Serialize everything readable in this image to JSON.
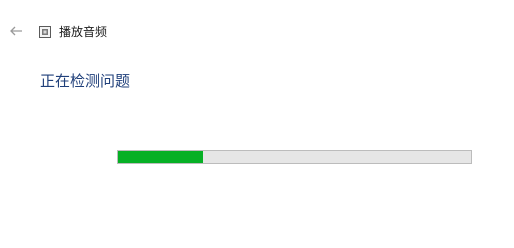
{
  "window": {
    "title": "播放音频",
    "back_icon": "back-arrow-icon",
    "app_icon": "troubleshooter-icon"
  },
  "main": {
    "heading": "正在检测问题",
    "progress": {
      "value_fraction": 0.24,
      "fill_color": "#06b025",
      "track_color": "#e6e6e6"
    }
  },
  "colors": {
    "heading": "#1f3f7a",
    "title_text": "#1a1a1a"
  }
}
